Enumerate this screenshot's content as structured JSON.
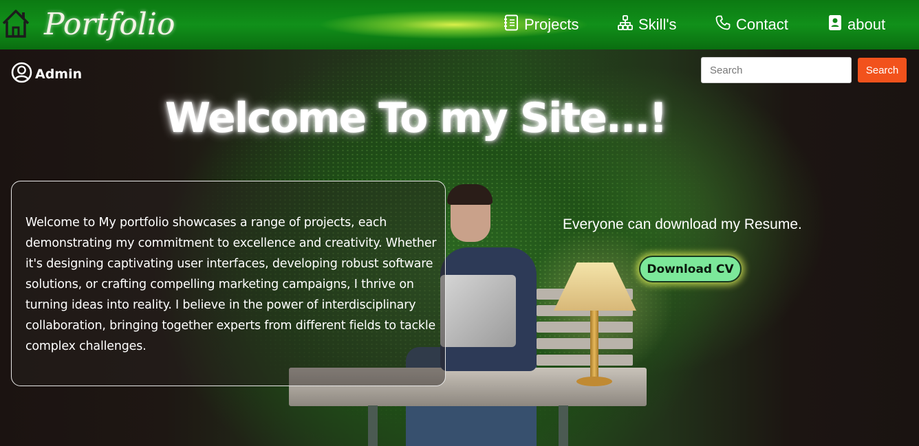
{
  "header": {
    "brand": "Portfolio",
    "nav": [
      {
        "label": "Projects",
        "icon": "notebook-icon"
      },
      {
        "label": "Skill's",
        "icon": "sitemap-icon"
      },
      {
        "label": "Contact",
        "icon": "phone-icon"
      },
      {
        "label": "about",
        "icon": "contact-card-icon"
      }
    ],
    "colors": {
      "bar": "#0f8a18",
      "highlight": "#d9f04a"
    }
  },
  "user": {
    "label": "Admin",
    "icon": "user-circle-icon"
  },
  "search": {
    "placeholder": "Search",
    "button_label": "Search",
    "button_color": "#f2521c"
  },
  "hero": {
    "title": "Welcome To my Site...!"
  },
  "intro": {
    "text": "Welcome to My portfolio showcases a range of projects, each demonstrating my commitment to excellence and creativity. Whether it's designing captivating user interfaces, developing robust software solutions, or crafting compelling marketing campaigns, I thrive on turning ideas into reality. I believe in the power of interdisciplinary collaboration, bringing together experts from different fields to tackle complex challenges."
  },
  "resume": {
    "text": "Everyone can download my Resume.",
    "button_label": "Download CV",
    "button_color": "#7ce89a"
  }
}
